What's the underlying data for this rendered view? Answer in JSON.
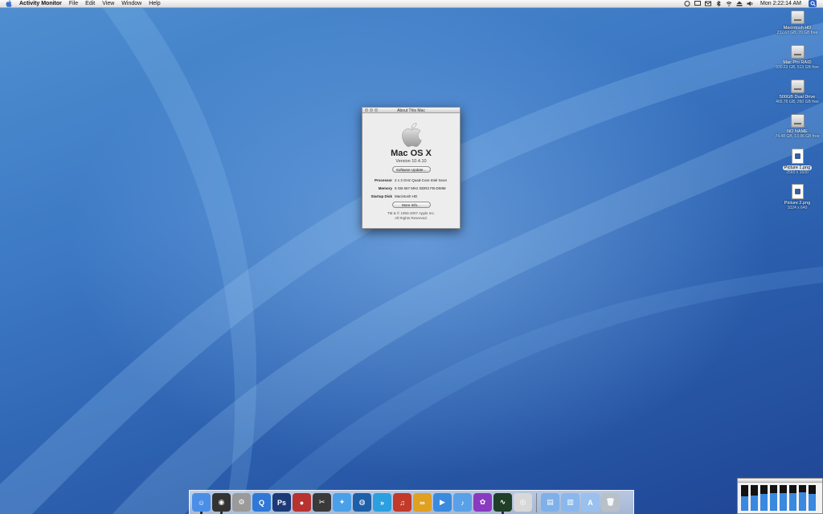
{
  "menubar": {
    "app_name": "Activity Monitor",
    "items": [
      "File",
      "Edit",
      "View",
      "Window",
      "Help"
    ],
    "clock": "Mon 2:22:14 AM",
    "tray_icons": [
      "activity-monitor-icon",
      "display-icon",
      "mail-icon",
      "bluetooth-icon",
      "wifi-icon",
      "eject-icon",
      "volume-icon",
      "spotlight-icon"
    ]
  },
  "desktop_icons": [
    {
      "name": "Macintosh HD",
      "info": "232.67 GB, 70 GB free",
      "kind": "disk"
    },
    {
      "name": "Mac Pro RAID",
      "info": "930.63 GB, 513 GB free",
      "kind": "disk"
    },
    {
      "name": "500GB Dual Drive",
      "info": "465.76 GB, 260 GB free",
      "kind": "disk"
    },
    {
      "name": "NO NAME",
      "info": "74.48 GB, 13.96 GB free",
      "kind": "disk"
    },
    {
      "name": "Picture 1.png",
      "info": "2560 x 1600",
      "kind": "file",
      "selected": true
    },
    {
      "name": "Picture 2.png",
      "info": "1024 x 640",
      "kind": "file",
      "selected": false
    }
  ],
  "about_window": {
    "title": "About This Mac",
    "os_name": "Mac OS X",
    "version": "Version 10.4.10",
    "software_update_label": "Software Update...",
    "processor_label": "Processor",
    "processor_value": "2 x 3 GHz Quad-Core Intel Xeon",
    "memory_label": "Memory",
    "memory_value": "9 GB 667 MHz DDR2 FB-DIMM",
    "startup_label": "Startup Disk",
    "startup_value": "Macintosh HD",
    "more_info_label": "More Info...",
    "copyright_line1": "TM & © 1983-2007 Apple Inc.",
    "copyright_line2": "All Rights Reserved."
  },
  "dock": {
    "apps": [
      {
        "name": "finder-icon",
        "color": "#4a8ee8",
        "glyph": "☺",
        "running": true
      },
      {
        "name": "dashboard-icon",
        "color": "#333333",
        "glyph": "◉",
        "running": true
      },
      {
        "name": "system-preferences-icon",
        "color": "#9a9a9a",
        "glyph": "⚙",
        "running": false
      },
      {
        "name": "quicktime-icon",
        "color": "#2f78d8",
        "glyph": "Q",
        "running": false
      },
      {
        "name": "photoshop-icon",
        "color": "#1c3a78",
        "glyph": "Ps",
        "running": false
      },
      {
        "name": "aperture-icon",
        "color": "#b8322f",
        "glyph": "●",
        "running": false
      },
      {
        "name": "final-cut-icon",
        "color": "#3a3a3a",
        "glyph": "✂",
        "running": false
      },
      {
        "name": "safari-icon",
        "color": "#4aa0e8",
        "glyph": "✦",
        "running": false
      },
      {
        "name": "globe-icon",
        "color": "#1f5fa8",
        "glyph": "◍",
        "running": false
      },
      {
        "name": "front-row-icon",
        "color": "#2aa0e0",
        "glyph": "»",
        "running": false
      },
      {
        "name": "garageband-icon",
        "color": "#c23a2a",
        "glyph": "♫",
        "running": false
      },
      {
        "name": "ichat-icon",
        "color": "#e0a020",
        "glyph": "∞",
        "running": false
      },
      {
        "name": "facetime-icon",
        "color": "#3a8ae0",
        "glyph": "▶",
        "running": false
      },
      {
        "name": "itunes-icon",
        "color": "#5aa0e8",
        "glyph": "♪",
        "running": false
      },
      {
        "name": "colorsync-icon",
        "color": "#8a3ac0",
        "glyph": "✿",
        "running": false
      },
      {
        "name": "activity-monitor-icon",
        "color": "#1f3f28",
        "glyph": "∿",
        "running": true
      },
      {
        "name": "ipod-icon",
        "color": "#d8d8d8",
        "glyph": "◎",
        "running": false
      }
    ],
    "stacks": [
      {
        "name": "documents-folder-icon",
        "color": "#7fb0e8",
        "glyph": "▤"
      },
      {
        "name": "downloads-folder-icon",
        "color": "#8ab8ec",
        "glyph": "▥"
      },
      {
        "name": "applications-folder-icon",
        "color": "#9ac0ee",
        "glyph": "A"
      },
      {
        "name": "trash-icon",
        "color": "#b8c0c8",
        "glyph": "🗑"
      }
    ]
  },
  "cpu_monitor": {
    "cores": [
      0.55,
      0.6,
      0.65,
      0.7,
      0.7,
      0.68,
      0.72,
      0.66
    ]
  }
}
